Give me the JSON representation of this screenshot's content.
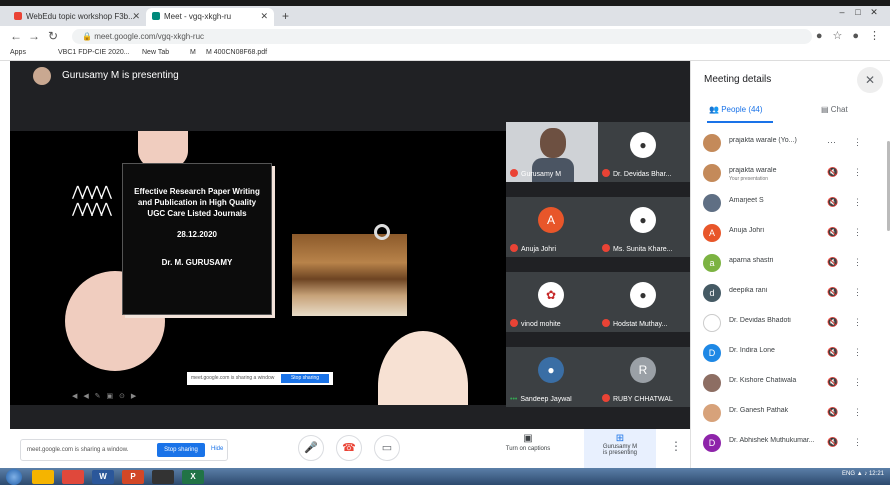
{
  "browser": {
    "tabs": [
      {
        "label": "WebEdu topic workshop F3b...",
        "fav_color": "#ea4335"
      },
      {
        "label": "Meet - vgq-xkgh-ru",
        "fav_color": "#00897b"
      }
    ],
    "new_tab": "+",
    "window_buttons": [
      "–",
      "□",
      "✕"
    ],
    "url": "meet.google.com/vgq-xkgh-ruc",
    "bookmarks": [
      "Apps",
      "VBC1 FDP-CIE 2020...",
      "New Tab",
      "M",
      "M 400CN08F68.pdf"
    ]
  },
  "meet": {
    "presenting_label": "Gurusamy M is presenting",
    "slide": {
      "title": "Effective Research Paper Writing and Publication in High Quality UGC Care Listed Journals",
      "date": "28.12.2020",
      "author": "Dr. M. GURUSAMY",
      "share_notice": "meet.google.com is sharing a window",
      "hide_button": "Stop sharing",
      "controls": "◀ ◀ ✎ ▣ ⊙ ▶"
    },
    "participants_grid": [
      {
        "name": "Gurusamy M",
        "type": "video"
      },
      {
        "name": "Dr. Devidas Bhar...",
        "avatar_color": "#ffffff",
        "initial": "",
        "muted": true
      },
      {
        "name": "Anuja Johri",
        "avatar_color": "#e8562a",
        "initial": "A",
        "muted": true
      },
      {
        "name": "Ms. Sunita Khare...",
        "avatar_color": "#ffffff",
        "initial": "",
        "muted": true
      },
      {
        "name": "vinod mohite",
        "avatar_color": "#ffffff",
        "initial": "",
        "muted": true
      },
      {
        "name": "Hodstat Muthay...",
        "avatar_color": "#ffffff",
        "initial": "",
        "muted": true
      },
      {
        "name": "Sandeep Jaywal",
        "avatar_color": "#3a6ea5",
        "initial": "",
        "muted": false
      },
      {
        "name": "RUBY CHHATWAL",
        "avatar_color": "#9aa0a6",
        "initial": "R",
        "muted": true
      }
    ],
    "bottom": {
      "sharing_text": "meet.google.com is sharing a window.",
      "stop_sharing": "Stop sharing",
      "hide": "Hide",
      "captions": "Turn on captions",
      "presenting_line1": "Gurusamy M",
      "presenting_line2": "is presenting",
      "more": "⋮"
    }
  },
  "panel": {
    "title": "Meeting details",
    "close": "✕",
    "tab_people": "People (44)",
    "tab_chat": "Chat",
    "people": [
      {
        "name": "prajakta warale (Yo...)",
        "avatar_color": "#c48a5a",
        "initial": "",
        "sub": "",
        "mic": "⋯"
      },
      {
        "name": "prajakta warale",
        "avatar_color": "#c48a5a",
        "initial": "",
        "sub": "Your presentation",
        "mic": "🔇"
      },
      {
        "name": "Amarjeet S",
        "avatar_color": "#5f6f84",
        "initial": "",
        "sub": "",
        "mic": "🔇"
      },
      {
        "name": "Anuja Johri",
        "avatar_color": "#e8562a",
        "initial": "A",
        "sub": "",
        "mic": "🔇"
      },
      {
        "name": "aparna shastri",
        "avatar_color": "#7cb342",
        "initial": "a",
        "sub": "",
        "mic": "🔇"
      },
      {
        "name": "deepika rani",
        "avatar_color": "#455a64",
        "initial": "d",
        "sub": "",
        "mic": "🔇"
      },
      {
        "name": "Dr. Devidas Bhadoti",
        "avatar_color": "#ffffff",
        "initial": "",
        "sub": "",
        "mic": "🔇"
      },
      {
        "name": "Dr. Indira Lone",
        "avatar_color": "#1e88e5",
        "initial": "D",
        "sub": "",
        "mic": "🔇"
      },
      {
        "name": "Dr. Kishore Chatiwala",
        "avatar_color": "#8d6e63",
        "initial": "",
        "sub": "",
        "mic": "🔇"
      },
      {
        "name": "Dr. Ganesh Pathak",
        "avatar_color": "#d7a27a",
        "initial": "",
        "sub": "",
        "mic": "🔇"
      },
      {
        "name": "Dr. Abhishek Muthukumar...",
        "avatar_color": "#8e24aa",
        "initial": "D",
        "sub": "",
        "mic": "🔇"
      }
    ]
  },
  "taskbar": {
    "apps": [
      {
        "label": "",
        "color": "#f5b400"
      },
      {
        "label": "",
        "color": "#e0483b"
      },
      {
        "label": "W",
        "color": "#2b579a"
      },
      {
        "label": "P",
        "color": "#d24726"
      },
      {
        "label": "",
        "color": "#333333"
      },
      {
        "label": "X",
        "color": "#217346"
      }
    ],
    "tray": "ENG ▲ ♪ 12:21"
  }
}
